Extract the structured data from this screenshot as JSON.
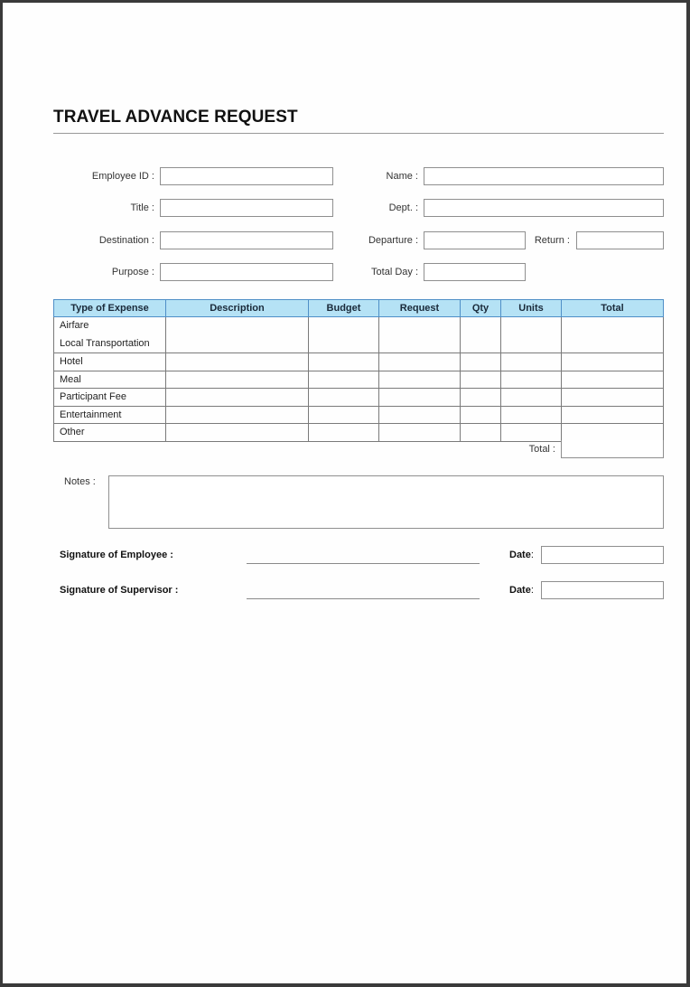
{
  "document": {
    "title": "TRAVEL ADVANCE REQUEST"
  },
  "fields": {
    "employee_id": {
      "label": "Employee ID :",
      "value": ""
    },
    "name": {
      "label": "Name :",
      "value": ""
    },
    "title": {
      "label": "Title :",
      "value": ""
    },
    "dept": {
      "label": "Dept. :",
      "value": ""
    },
    "destination": {
      "label": "Destination :",
      "value": ""
    },
    "departure": {
      "label": "Departure :",
      "value": ""
    },
    "return": {
      "label": "Return :",
      "value": ""
    },
    "purpose": {
      "label": "Purpose :",
      "value": ""
    },
    "total_day": {
      "label": "Total Day :",
      "value": ""
    }
  },
  "expense_table": {
    "columns": [
      "Type of Expense",
      "Description",
      "Budget",
      "Request",
      "Qty",
      "Units",
      "Total"
    ],
    "rows": [
      {
        "type": "Airfare",
        "type2": "Local Transportation",
        "description": "",
        "budget": "",
        "request": "",
        "qty": "",
        "units": "",
        "total": ""
      },
      {
        "type": "Hotel",
        "description": "",
        "budget": "",
        "request": "",
        "qty": "",
        "units": "",
        "total": ""
      },
      {
        "type": "Meal",
        "description": "",
        "budget": "",
        "request": "",
        "qty": "",
        "units": "",
        "total": ""
      },
      {
        "type": "Participant Fee",
        "description": "",
        "budget": "",
        "request": "",
        "qty": "",
        "units": "",
        "total": ""
      },
      {
        "type": "Entertainment",
        "description": "",
        "budget": "",
        "request": "",
        "qty": "",
        "units": "",
        "total": ""
      },
      {
        "type": "Other",
        "description": "",
        "budget": "",
        "request": "",
        "qty": "",
        "units": "",
        "total": ""
      }
    ],
    "total_label": "Total :",
    "total_value": "",
    "header_color": "#b5e2f5",
    "header_border_color": "#4f8fc7"
  },
  "notes": {
    "label": "Notes :",
    "value": ""
  },
  "signatures": {
    "employee": {
      "label": "Signature of Employee :",
      "date_label": "Date",
      "date_colon": ":",
      "date_value": ""
    },
    "supervisor": {
      "label": "Signature of Supervisor :",
      "date_label": "Date",
      "date_colon": ":",
      "date_value": ""
    }
  }
}
